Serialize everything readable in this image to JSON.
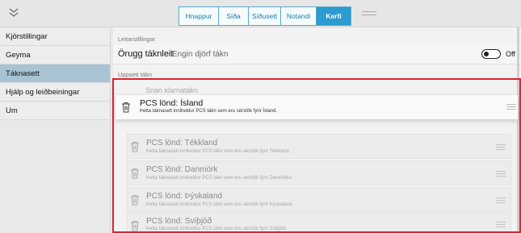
{
  "topbar": {
    "collapse_icon": "chevrons-down-icon",
    "tabs": [
      {
        "label": "Hnappur",
        "active": false
      },
      {
        "label": "Síða",
        "active": false
      },
      {
        "label": "Síðusett",
        "active": false
      },
      {
        "label": "Notandi",
        "active": false
      },
      {
        "label": "Kerfi",
        "active": true
      }
    ]
  },
  "sidebar": {
    "items": [
      {
        "label": "Kjörstillingar",
        "active": false
      },
      {
        "label": "Geyma",
        "active": false
      },
      {
        "label": "Táknasett",
        "active": true
      },
      {
        "label": "Hjálp og leiðbeiningar",
        "active": false
      },
      {
        "label": "Um",
        "active": false
      }
    ]
  },
  "main": {
    "settings_label": "Leitarstillingar",
    "safe_title": "Örugg táknleit",
    "safe_sub": "Engin djörf tákn",
    "toggle_text": "Off",
    "installed_label": "Uppsett tákn",
    "ghost_row": "Snan klarnatákn",
    "dragging_row": {
      "title": "PCS lönd: Ísland",
      "desc": "Þetta táknasett inniheldur PCS tákn sem eru sérstök fyrir Ísland."
    },
    "rows": [
      {
        "title": "PCS lönd: Tékkland",
        "desc": "Þetta táknasett inniheldur PCS tákn sem eru sérstök fyrir Tékkland."
      },
      {
        "title": "PCS lönd: Danmörk",
        "desc": "Þetta táknasett inniheldur PCS tákn sem eru sérstök fyrir Danmörku."
      },
      {
        "title": "PCS lönd: Þýskaland",
        "desc": "Þetta táknasett inniheldur PCS tákn sem eru sérstök fyrir Þýskaland."
      },
      {
        "title": "PCS lönd: Svíþjóð",
        "desc": "Þetta táknasett inniheldur PCS tákn sem eru sérstök fyrir Svíþjóð."
      }
    ]
  },
  "colors": {
    "accent": "#2b9bd0",
    "nav_active": "#a8c4d4",
    "highlight_frame": "#e0202e"
  }
}
